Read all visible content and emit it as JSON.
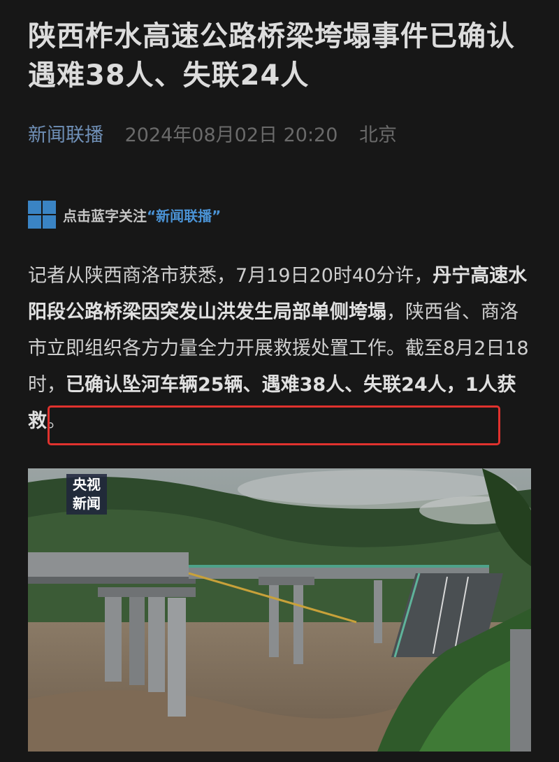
{
  "article": {
    "title": "陕西柞水高速公路桥梁垮塌事件已确认遇难38人、失联24人",
    "source": "新闻联播",
    "date": "2024年08月02日 20:20",
    "location": "北京"
  },
  "follow_bar": {
    "prefix": "点击蓝字关注",
    "link": "“新闻联播”",
    "icon": "grid-logo-icon"
  },
  "body": {
    "p1_part1": "记者从陕西商洛市获悉，7月19日20时40分许，",
    "p1_bold1": "丹宁高速水阳段公路桥梁因突发山洪发生局部单侧垮塌",
    "p1_part2": "，陕西省、商洛市立即组织各方力量全力开展救援处置工作。截至8月2日18时，",
    "p1_bold2": "已确认坠河车辆25辆、遇难38人、失联24人，1人获救",
    "p1_end": "。"
  },
  "photo": {
    "badge_line1": "央视",
    "badge_line2": "新闻",
    "description_icon": "bridge-collapse-photo"
  },
  "colors": {
    "background": "#171717",
    "source_blue": "#6f8fb6",
    "link_blue": "#4a92d4",
    "highlight_red": "#e0322e"
  }
}
